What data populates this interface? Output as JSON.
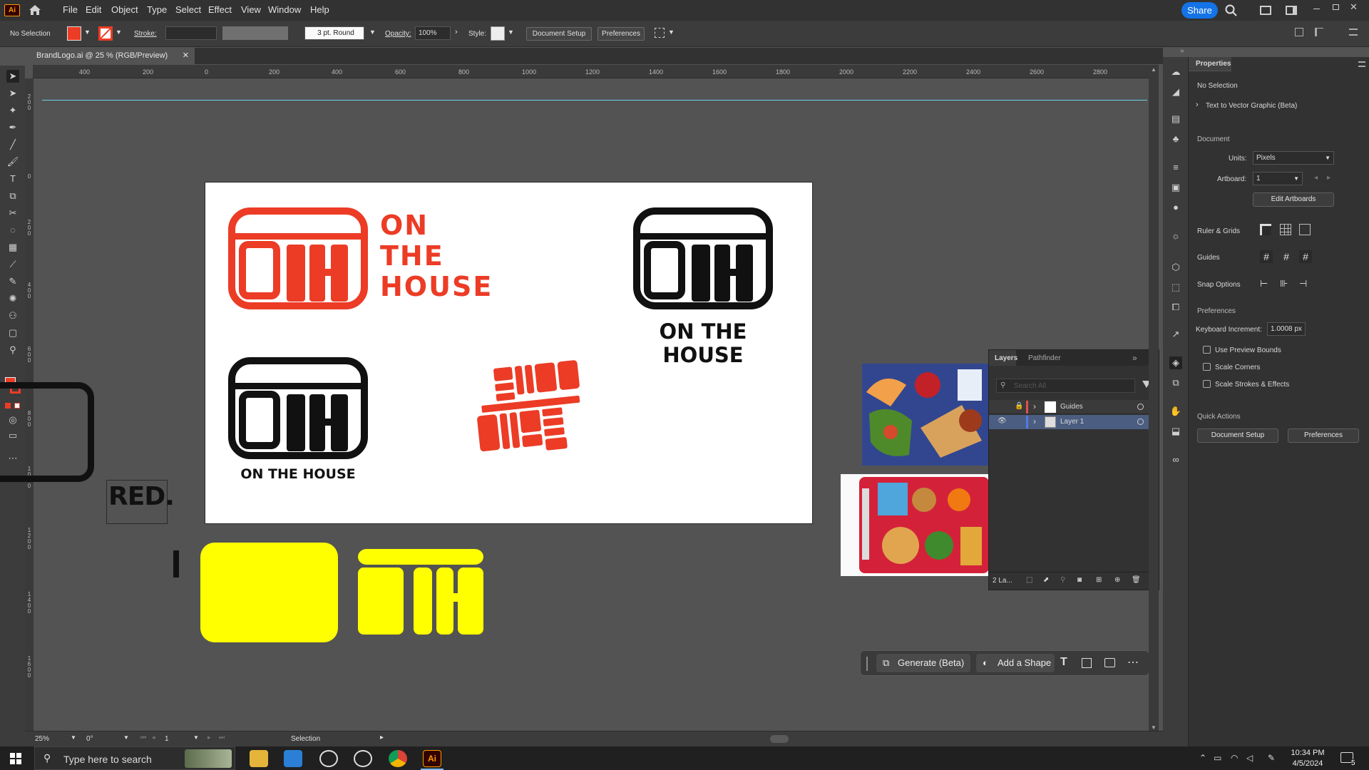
{
  "app": {
    "logo_text": "Ai",
    "share_label": "Share"
  },
  "menu": [
    "File",
    "Edit",
    "Object",
    "Type",
    "Select",
    "Effect",
    "View",
    "Window",
    "Help"
  ],
  "control_bar": {
    "selection_state": "No Selection",
    "stroke_label": "Stroke:",
    "brush_value": "3 pt. Round",
    "opacity_label": "Opacity:",
    "opacity_value": "100%",
    "style_label": "Style:",
    "document_setup": "Document Setup",
    "preferences": "Preferences"
  },
  "document_tab": {
    "title": "BrandLogo.ai @ 25 % (RGB/Preview)"
  },
  "ruler": {
    "h_ticks": [
      "400",
      "200",
      "0",
      "200",
      "400",
      "600",
      "800",
      "1000",
      "1200",
      "1400",
      "1600",
      "1800",
      "2000",
      "2200",
      "2400",
      "2600",
      "2800"
    ],
    "v_ticks": [
      "200",
      "0",
      "200",
      "400",
      "600",
      "800",
      "1000",
      "1200",
      "1400",
      "1600"
    ]
  },
  "artwork": {
    "wordmark_line1": "ON",
    "wordmark_line2": "THE",
    "wordmark_line3": "HOUSE",
    "stacked_line1": "ON THE",
    "stacked_line2": "HOUSE",
    "inline_text": "ON THE HOUSE",
    "red_tag": "RED.",
    "brand_red": "#ec3c26",
    "brand_black": "#111111",
    "brand_yellow": "#ffff00"
  },
  "properties_panel": {
    "tab": "Properties",
    "selection_state": "No Selection",
    "text_to_vector": "Text to Vector Graphic (Beta)",
    "document_heading": "Document",
    "units_label": "Units:",
    "units_value": "Pixels",
    "artboard_label": "Artboard:",
    "artboard_value": "1",
    "edit_artboards": "Edit Artboards",
    "ruler_grids": "Ruler & Grids",
    "guides": "Guides",
    "snap_options": "Snap Options",
    "preferences_heading": "Preferences",
    "keyboard_increment_label": "Keyboard Increment:",
    "keyboard_increment_value": "1.0008 px",
    "use_preview_bounds": "Use Preview Bounds",
    "scale_corners": "Scale Corners",
    "scale_strokes": "Scale Strokes & Effects",
    "quick_actions": "Quick Actions",
    "qa_document_setup": "Document Setup",
    "qa_preferences": "Preferences"
  },
  "layers_panel": {
    "tab_layers": "Layers",
    "tab_pathfinder": "Pathfinder",
    "search_placeholder": "Search All",
    "layers": [
      {
        "name": "Guides"
      },
      {
        "name": "Layer 1"
      }
    ],
    "footer_count": "2 La..."
  },
  "contextual_bar": {
    "generate": "Generate (Beta)",
    "add_shape": "Add a Shape"
  },
  "status_bar": {
    "zoom": "25%",
    "rotation": "0°",
    "artboard_nav": "1",
    "tool": "Selection"
  },
  "taskbar": {
    "search_placeholder": "Type here to search",
    "time": "10:34 PM",
    "date": "4/5/2024",
    "notifications": "5"
  }
}
